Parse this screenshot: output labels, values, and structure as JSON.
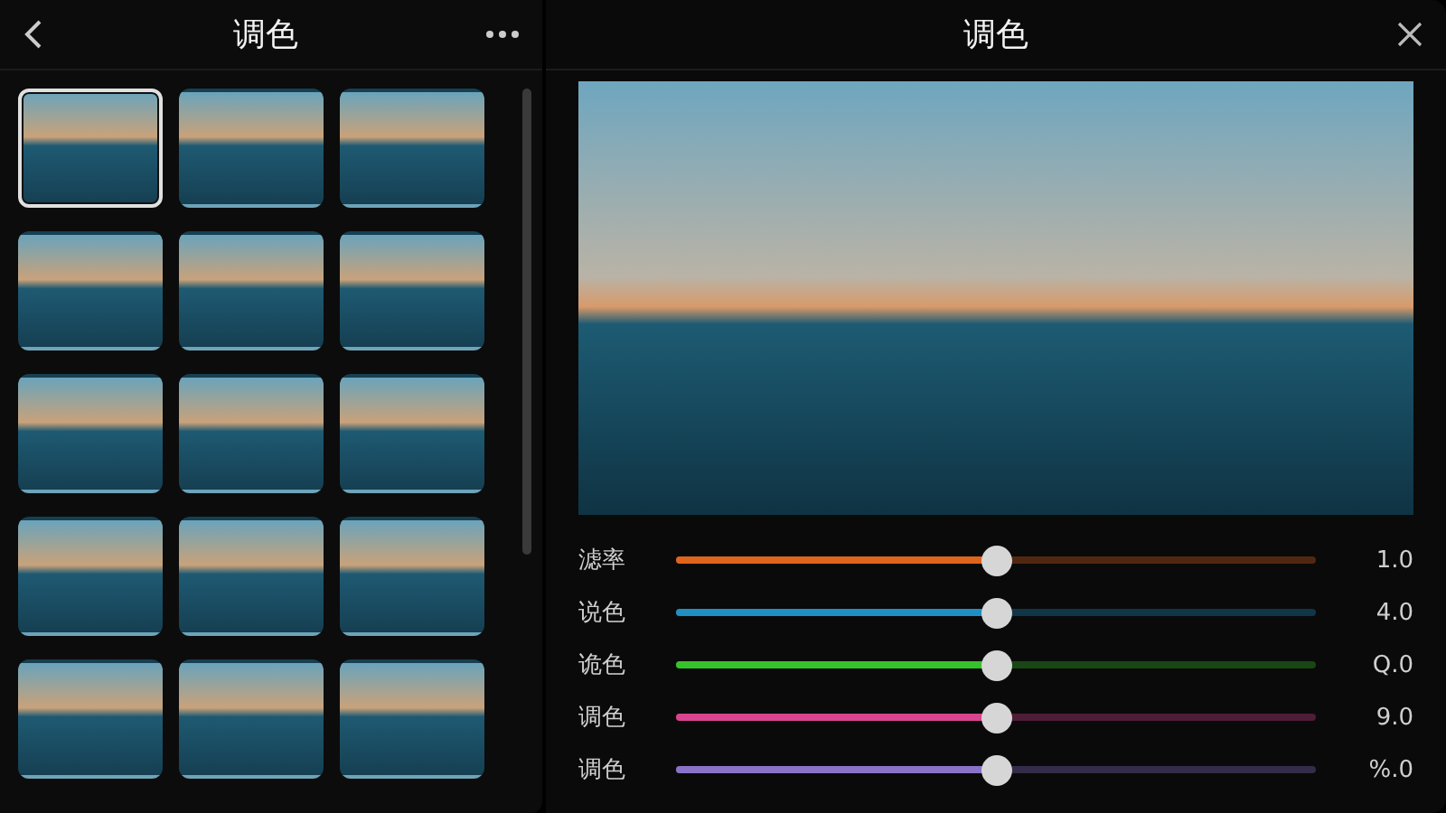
{
  "left_panel": {
    "title": "调色",
    "thumbnails": [
      {
        "selected": true
      },
      {
        "selected": false
      },
      {
        "selected": false
      },
      {
        "selected": false
      },
      {
        "selected": false
      },
      {
        "selected": false
      },
      {
        "selected": false
      },
      {
        "selected": false
      },
      {
        "selected": false
      },
      {
        "selected": false
      },
      {
        "selected": false
      },
      {
        "selected": false
      },
      {
        "selected": false
      },
      {
        "selected": false
      },
      {
        "selected": false
      }
    ]
  },
  "right_panel": {
    "title": "调色",
    "sliders": [
      {
        "label": "滤率",
        "level": 0.5,
        "reading": "1.0",
        "color": "#e0651c"
      },
      {
        "label": "说色",
        "level": 0.5,
        "reading": "4.0",
        "color": "#1f8fc4"
      },
      {
        "label": "诡色",
        "level": 0.5,
        "reading": "Q.0",
        "color": "#36c22a"
      },
      {
        "label": "调色",
        "level": 0.5,
        "reading": "9.0",
        "color": "#d8448f"
      },
      {
        "label": "调色",
        "level": 0.5,
        "reading": "%.0",
        "color": "#8a72c8"
      }
    ]
  }
}
